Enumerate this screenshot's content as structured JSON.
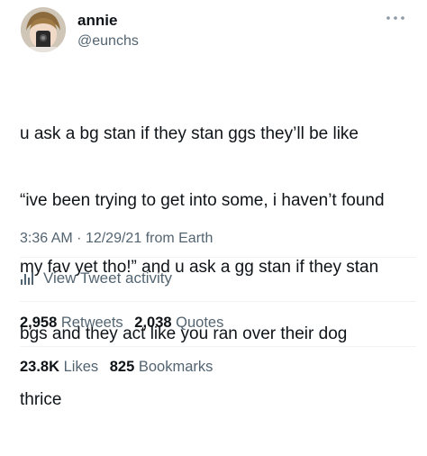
{
  "author": {
    "name": "annie",
    "handle": "@eunchs"
  },
  "tweet": {
    "text": "u ask a bg stan if they stan ggs they’ll be like “ive been trying to get into some, i haven’t found my fav yet tho!” and u ask a gg stan if they stan bgs and they act like you ran over their dog thrice",
    "lines": [
      "u ask a bg stan if they stan ggs they’ll be like",
      "“ive been trying to get into some, i haven’t found",
      "my fav yet tho!” and u ask a gg stan if they stan",
      "bgs and they act like you ran over their dog",
      "thrice"
    ],
    "time": "3:36 AM",
    "separator": "·",
    "date": "12/29/21",
    "source": "from Earth"
  },
  "activity": {
    "label": "View Tweet activity",
    "icon": "bar-chart-icon"
  },
  "stats": {
    "retweets_count": "2,958",
    "retweets_label": "Retweets",
    "quotes_count": "2,038",
    "quotes_label": "Quotes",
    "likes_count": "23.8K",
    "likes_label": "Likes",
    "bookmarks_count": "825",
    "bookmarks_label": "Bookmarks"
  },
  "colors": {
    "text_primary": "#0f1419",
    "text_secondary": "#536471",
    "divider": "#eff3f4"
  }
}
